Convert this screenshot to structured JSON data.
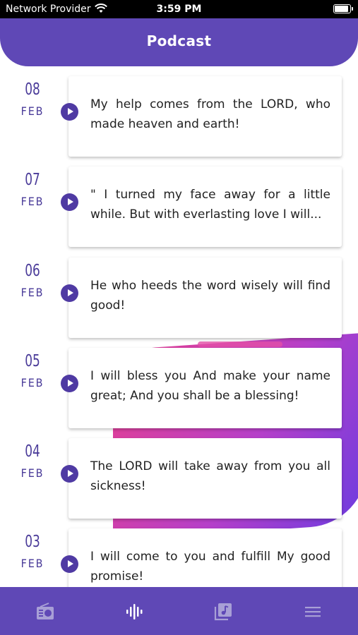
{
  "status_bar": {
    "carrier": "Network Provider",
    "time": "3:59 PM"
  },
  "header": {
    "title": "Podcast"
  },
  "podcasts": [
    {
      "day": "08",
      "month": "FEB",
      "text": "My help comes from the LORD, who made heaven and earth!"
    },
    {
      "day": "07",
      "month": "FEB",
      "text": "\" I turned my face away for a little while.  But with everlasting love I will..."
    },
    {
      "day": "06",
      "month": "FEB",
      "text": "He who heeds the word wisely will find good!"
    },
    {
      "day": "05",
      "month": "FEB",
      "text": "I will bless you And make your name great;  And you shall be a blessing!"
    },
    {
      "day": "04",
      "month": "FEB",
      "text": "The LORD will take away from you all sickness!"
    },
    {
      "day": "03",
      "month": "FEB",
      "text": "I will come to you and fulfill My good promise!"
    }
  ],
  "bottom_nav": {
    "items": [
      {
        "icon": "radio-icon"
      },
      {
        "icon": "podcast-waveform-icon",
        "active": true
      },
      {
        "icon": "music-library-icon"
      },
      {
        "icon": "menu-icon"
      }
    ]
  },
  "colors": {
    "primary": "#5f48b6",
    "date_text": "#4a3b99",
    "play_button": "#4f3aa3",
    "nav_icon_inactive": "#a89fd6"
  }
}
